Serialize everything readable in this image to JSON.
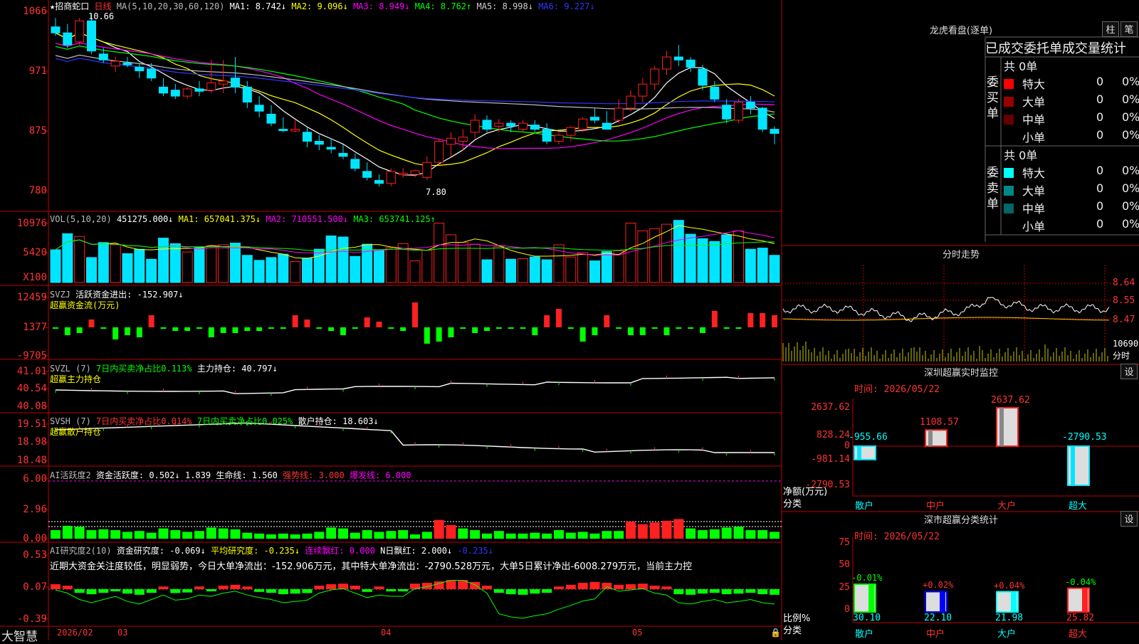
{
  "colors": {
    "up": "#ff2020",
    "down": "#00e5ff",
    "grid": "#c00000",
    "bg": "#000000"
  },
  "main": {
    "title": "★招商蛇口",
    "period": "日线",
    "ma_label": "MA(5,10,20,30,60,120)",
    "ma_values": [
      {
        "name": "MA1:",
        "value": "8.742↓",
        "color": "#ffffff"
      },
      {
        "name": "MA2:",
        "value": "9.096↓",
        "color": "#ffff00"
      },
      {
        "name": "MA3:",
        "value": "8.949↓",
        "color": "#ff00ff"
      },
      {
        "name": "MA4:",
        "value": "8.762↑",
        "color": "#00ff00"
      },
      {
        "name": "MA5:",
        "value": "8.998↓",
        "color": "#cccccc"
      },
      {
        "name": "MA6:",
        "value": "9.227↓",
        "color": "#3333ff"
      }
    ],
    "yticks": [
      "1066",
      "971",
      "875",
      "780"
    ],
    "hi_label": "10.66",
    "lo_label": "7.80"
  },
  "vol": {
    "label": "VOL(5,10,20)",
    "value": "451275.000↓",
    "ma1": "MA1: 657041.375↓",
    "ma2": "MA2: 710551.500↓",
    "ma3": "MA3: 653741.125↑",
    "yticks": [
      "10976",
      "5420"
    ],
    "unit": "X100"
  },
  "svzj": {
    "label": "SVZJ",
    "text": "活跃资金进出: -152.907↓",
    "sub": "超赢资金流(万元)",
    "yticks": [
      "12459",
      "1377",
      "-9705"
    ]
  },
  "svzl": {
    "label": "SVZL (7)",
    "t1": "7日内买卖净占比0.113%",
    "t2": "主力持仓: 40.797↓",
    "sub": "超赢主力持仓",
    "yticks": [
      "41.01",
      "40.54",
      "40.08"
    ]
  },
  "svsh": {
    "label": "SVSH (7)",
    "t1": "7日内买卖净占比0.014%",
    "t2": "7日内买卖净占比0.025%",
    "t3": "散户持仓: 18.603↓",
    "sub": "超赢散户持仓",
    "yticks": [
      "19.51",
      "18.98",
      "18.48"
    ]
  },
  "ai1": {
    "label": "AI活跃度2",
    "t1": "资金活跃度: 0.502↓",
    "t2": "1.839",
    "t3": "生命线: 1.560",
    "t4": "强势线: 3.000",
    "t5": "爆发线: 6.000",
    "yticks": [
      "6.00",
      "2.96",
      "0.00"
    ]
  },
  "ai2": {
    "label": "AI研究度2(10)",
    "t1": "资金研究度: -0.069↓",
    "t2": "平均研究度: -0.235↓",
    "t3": "连续飘红: 0.000",
    "t4": "N日飘红: 2.000↓",
    "t5": "-0.235↓",
    "comment": "近期大资金关注度较低，明显弱势，今日大单净流出：-152.906万元，其中特大单净流出：-2790.528万元，大单5日累计净出-6008.279万元，当前主力控",
    "yticks": [
      "0.53",
      "0.07",
      "-0.39"
    ]
  },
  "bottom": {
    "brand": "大智慧",
    "d1": "2026/02",
    "d2": "03",
    "d3": "04",
    "d4": "05"
  },
  "right": {
    "lhkp_title": "龙虎看盘(逐单)",
    "btn_zhu": "柱",
    "btn_bi": "笔",
    "stat_title": "已成交委托单成交量统计",
    "buy_label": "委买单",
    "sell_label": "委卖单",
    "buy_total": "共 0单",
    "sell_total": "共 0单",
    "buy_rows": [
      {
        "name": "特大",
        "n": "0",
        "p": "0%",
        "color": "#ff0000"
      },
      {
        "name": "大单",
        "n": "0",
        "p": "0%",
        "color": "#990000"
      },
      {
        "name": "中单",
        "n": "0",
        "p": "0%",
        "color": "#660000"
      },
      {
        "name": "小单",
        "n": "0",
        "p": "0%",
        "color": ""
      }
    ],
    "sell_rows": [
      {
        "name": "特大",
        "n": "0",
        "p": "0%",
        "color": "#00ffff"
      },
      {
        "name": "大单",
        "n": "0",
        "p": "0%",
        "color": "#008888"
      },
      {
        "name": "中单",
        "n": "0",
        "p": "0%",
        "color": "#006666"
      },
      {
        "name": "小单",
        "n": "0",
        "p": "0%",
        "color": ""
      }
    ],
    "fenshi_title": "分时走势",
    "fenshi_yticks": [
      "8.64",
      "8.55",
      "8.47"
    ],
    "fenshi_vol": "10690",
    "fenshi_unit": "分时",
    "rt_title": "深圳超赢实时监控",
    "rt_btn": "设",
    "rt_time": "时间: 2026/05/22",
    "rt_yticks": [
      "2637.62",
      "828.24",
      "0",
      "-981.14",
      "-2790.53"
    ],
    "rt_ylabel": "净额(万元)",
    "rt_xlabel": "分类",
    "cls_title": "深市超赢分类统计",
    "cls_btn": "设",
    "cls_time": "时间: 2026/05/22",
    "cls_yticks": [
      "75",
      "50",
      "25",
      "0"
    ],
    "cls_ylabel": "比例%",
    "cls_xlabel": "分类"
  },
  "chart_data": [
    {
      "type": "bar",
      "title": "深圳超赢实时监控",
      "categories": [
        "散户",
        "中户",
        "大户",
        "超大"
      ],
      "values": [
        -955.66,
        1108.57,
        2637.62,
        -2790.53
      ],
      "ylim": [
        -2790.53,
        2637.62
      ]
    },
    {
      "type": "bar",
      "title": "深市超赢分类统计",
      "categories": [
        "散户",
        "中户",
        "大户",
        "超大"
      ],
      "values": [
        30.1,
        22.1,
        21.98,
        25.82
      ],
      "change_labels": [
        "-0.01%",
        "+0.02%",
        "+0.04%",
        "-0.04%"
      ],
      "ylim": [
        0,
        75
      ]
    },
    {
      "type": "candlestick",
      "title": "招商蛇口 日线",
      "ylim": [
        7.8,
        10.66
      ],
      "ohlc": [
        [
          10.45,
          10.6,
          10.3,
          10.35
        ],
        [
          10.35,
          10.5,
          10.1,
          10.15
        ],
        [
          10.2,
          10.6,
          10.15,
          10.55
        ],
        [
          10.55,
          10.66,
          10.0,
          10.05
        ],
        [
          10.0,
          10.1,
          9.85,
          9.9
        ],
        [
          9.8,
          9.95,
          9.7,
          9.88
        ],
        [
          9.85,
          9.95,
          9.78,
          9.82
        ],
        [
          9.78,
          9.85,
          9.6,
          9.72
        ],
        [
          9.75,
          9.85,
          9.55,
          9.6
        ],
        [
          9.45,
          9.6,
          9.3,
          9.35
        ],
        [
          9.4,
          9.5,
          9.25,
          9.3
        ],
        [
          9.3,
          9.45,
          9.25,
          9.42
        ],
        [
          9.42,
          9.55,
          9.3,
          9.38
        ],
        [
          9.4,
          9.9,
          9.35,
          9.52
        ],
        [
          9.5,
          9.9,
          9.35,
          9.55
        ],
        [
          9.6,
          9.95,
          9.35,
          9.45
        ],
        [
          9.45,
          9.55,
          9.1,
          9.2
        ],
        [
          9.15,
          9.3,
          8.95,
          9.05
        ],
        [
          9.0,
          9.15,
          8.8,
          8.85
        ],
        [
          8.75,
          8.95,
          8.7,
          8.74
        ],
        [
          8.72,
          8.9,
          8.7,
          8.75
        ],
        [
          8.7,
          8.8,
          8.45,
          8.55
        ],
        [
          8.55,
          8.65,
          8.4,
          8.5
        ],
        [
          8.45,
          8.6,
          8.35,
          8.42
        ],
        [
          8.35,
          8.5,
          8.25,
          8.3
        ],
        [
          8.25,
          8.35,
          8.05,
          8.1
        ],
        [
          8.05,
          8.2,
          7.9,
          7.95
        ],
        [
          7.9,
          8.0,
          7.8,
          7.85
        ],
        [
          7.85,
          8.1,
          7.8,
          8.05
        ],
        [
          8.0,
          8.1,
          7.95,
          8.02
        ],
        [
          8.0,
          8.08,
          7.95,
          8.06
        ],
        [
          7.95,
          8.3,
          7.9,
          8.2
        ],
        [
          8.2,
          8.6,
          8.15,
          8.55
        ],
        [
          8.5,
          8.7,
          8.3,
          8.6
        ],
        [
          8.55,
          8.75,
          8.4,
          8.62
        ],
        [
          8.7,
          9.0,
          8.6,
          8.9
        ],
        [
          8.9,
          8.98,
          8.7,
          8.75
        ],
        [
          8.8,
          8.92,
          8.7,
          8.85
        ],
        [
          8.85,
          8.9,
          8.7,
          8.8
        ],
        [
          8.75,
          8.9,
          8.7,
          8.85
        ],
        [
          8.82,
          8.9,
          8.7,
          8.75
        ],
        [
          8.75,
          8.85,
          8.5,
          8.55
        ],
        [
          8.55,
          8.7,
          8.5,
          8.65
        ],
        [
          8.65,
          8.8,
          8.55,
          8.78
        ],
        [
          8.75,
          8.95,
          8.7,
          8.92
        ],
        [
          8.95,
          9.1,
          8.85,
          8.9
        ],
        [
          8.85,
          9.05,
          8.8,
          8.75
        ],
        [
          8.9,
          9.25,
          8.85,
          9.1
        ],
        [
          9.1,
          9.4,
          9.05,
          9.3
        ],
        [
          9.3,
          9.6,
          9.2,
          9.5
        ],
        [
          9.5,
          9.8,
          9.4,
          9.75
        ],
        [
          9.75,
          10.05,
          9.65,
          9.95
        ],
        [
          9.95,
          10.15,
          9.8,
          9.9
        ],
        [
          9.9,
          9.95,
          9.7,
          9.78
        ],
        [
          9.75,
          9.82,
          9.4,
          9.48
        ],
        [
          9.45,
          9.55,
          9.2,
          9.25
        ],
        [
          9.15,
          9.25,
          8.85,
          8.92
        ],
        [
          8.9,
          9.25,
          8.85,
          9.2
        ],
        [
          9.2,
          9.3,
          9.0,
          9.1
        ],
        [
          9.1,
          9.12,
          8.7,
          8.75
        ],
        [
          8.75,
          8.8,
          8.5,
          8.68
        ]
      ]
    }
  ]
}
